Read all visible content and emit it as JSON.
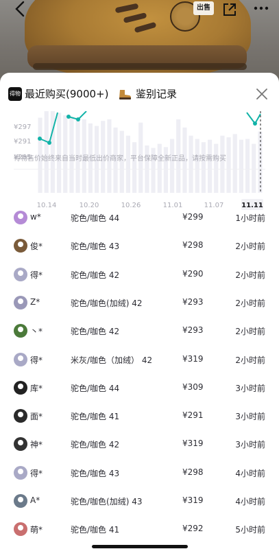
{
  "header": {
    "back_icon": "chevron-left-icon",
    "share_icon": "share-icon",
    "more_icon": "more-dots-icon",
    "boot_tag": "出售"
  },
  "tabs": [
    {
      "label": "最近购买(9000+)",
      "icon": "app-logo-icon",
      "icon_text": "得物"
    },
    {
      "label": "鉴别记录",
      "icon": "boot-icon"
    }
  ],
  "close_icon": "close-icon",
  "chart_data": {
    "type": "bar",
    "y_ticks": [
      "¥297",
      "¥291",
      "¥285"
    ],
    "x_ticks": [
      "10.14",
      "10.20",
      "10.26",
      "11.01",
      "11.07",
      "11.11"
    ],
    "highlight_tick": "11.11",
    "bars": [
      0.92,
      1.0,
      1.0,
      0.98,
      0.95,
      0.93,
      0.92,
      0.9,
      0.85,
      0.82,
      0.88,
      0.9,
      0.8,
      0.76,
      0.7,
      0.62,
      0.86,
      0.58,
      0.55,
      0.6,
      0.56,
      0.66,
      0.9,
      0.8,
      0.7,
      0.66,
      0.62,
      0.65,
      0.6,
      0.7,
      0.68,
      0.72,
      0.65,
      0.66,
      0.6,
      0.75
    ]
  },
  "notice": "得物售价始终来自当时最低出价商家，平台保障全新正品，请按需购买",
  "purchases": [
    {
      "name": "w*",
      "spec": "驼色/咖色 44",
      "price": "¥299",
      "time": "1小时前",
      "avatar_color": "#b58bd6"
    },
    {
      "name": "俊*",
      "spec": "驼色/咖色 43",
      "price": "¥298",
      "time": "2小时前",
      "avatar_color": "#7a5b3a"
    },
    {
      "name": "得*",
      "spec": "驼色/咖色 42",
      "price": "¥290",
      "time": "2小时前",
      "avatar_color": "#a9a9c6"
    },
    {
      "name": "Z*",
      "spec": "驼色/咖色(加绒)  42",
      "price": "¥293",
      "time": "2小时前",
      "avatar_color": "#9a98b8"
    },
    {
      "name": "丶*",
      "spec": "驼色/咖色 42",
      "price": "¥293",
      "time": "2小时前",
      "avatar_color": "#4b7a3a"
    },
    {
      "name": "得*",
      "spec": "米灰/咖色（加绒） 42",
      "price": "¥319",
      "time": "2小时前",
      "avatar_color": "#a9a9c6"
    },
    {
      "name": "库*",
      "spec": "驼色/咖色 44",
      "price": "¥309",
      "time": "3小时前",
      "avatar_color": "#222222"
    },
    {
      "name": "面*",
      "spec": "驼色/咖色 41",
      "price": "¥291",
      "time": "3小时前",
      "avatar_color": "#2b2b2b"
    },
    {
      "name": "神*",
      "spec": "驼色/咖色 42",
      "price": "¥319",
      "time": "3小时前",
      "avatar_color": "#333333"
    },
    {
      "name": "得*",
      "spec": "驼色/咖色 43",
      "price": "¥298",
      "time": "4小时前",
      "avatar_color": "#a9a9c6"
    },
    {
      "name": "A*",
      "spec": "驼色/咖色(加绒)  43",
      "price": "¥319",
      "time": "4小时前",
      "avatar_color": "#6b7a8a"
    },
    {
      "name": "萌*",
      "spec": "驼色/咖色 41",
      "price": "¥292",
      "time": "5小时前",
      "avatar_color": "#c96f6f"
    }
  ]
}
